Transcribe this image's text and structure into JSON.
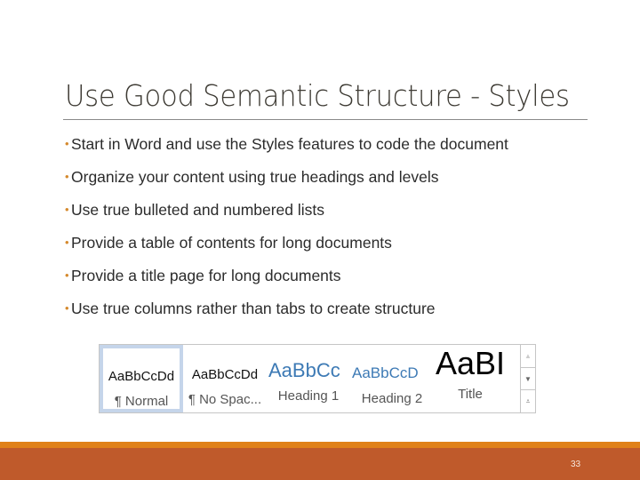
{
  "slide": {
    "title": "Use Good Semantic Structure - Styles",
    "bullet_glyph": "•",
    "bullets": [
      "Start in Word and use the Styles features to code the document",
      "Organize your content using true headings and levels",
      "Use true bulleted and numbered lists",
      "Provide a table of contents for long documents",
      "Provide a title page for long documents",
      "Use true columns rather than tabs to create structure"
    ],
    "page_number": "33"
  },
  "styles_gallery": {
    "items": [
      {
        "preview": "AaBbCcDd",
        "label": "¶ Normal",
        "selected": true
      },
      {
        "preview": "AaBbCcDd",
        "label": "¶ No Spac...",
        "selected": false
      },
      {
        "preview": "AaBbCc",
        "label": "Heading 1",
        "selected": false
      },
      {
        "preview": "AaBbCcD",
        "label": "Heading 2",
        "selected": false
      },
      {
        "preview": "AaBI",
        "label": "Title",
        "selected": false
      }
    ],
    "scroll": {
      "up_icon": "▲",
      "down_icon": "▼",
      "more_icon": "⩡"
    }
  },
  "colors": {
    "bullet": "#d58a2e",
    "footer_stripe": "#e08119",
    "footer_band": "#bf5a2b",
    "heading_preview": "#3d7ab5",
    "selection": "#c5d5ea"
  }
}
